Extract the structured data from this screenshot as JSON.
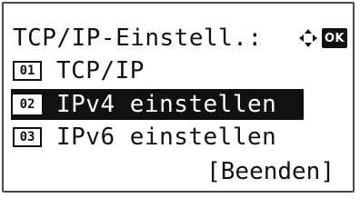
{
  "screen": {
    "title": "TCP/IP-Einstell.:",
    "nav_icon": "four-way-arrow-icon",
    "ok_label": "OK",
    "items": [
      {
        "number": "01",
        "label": "TCP/IP",
        "selected": false
      },
      {
        "number": "02",
        "label": "IPv4 einstellen",
        "selected": true
      },
      {
        "number": "03",
        "label": "IPv6 einstellen",
        "selected": false
      }
    ],
    "end_label": "[Beenden]"
  }
}
